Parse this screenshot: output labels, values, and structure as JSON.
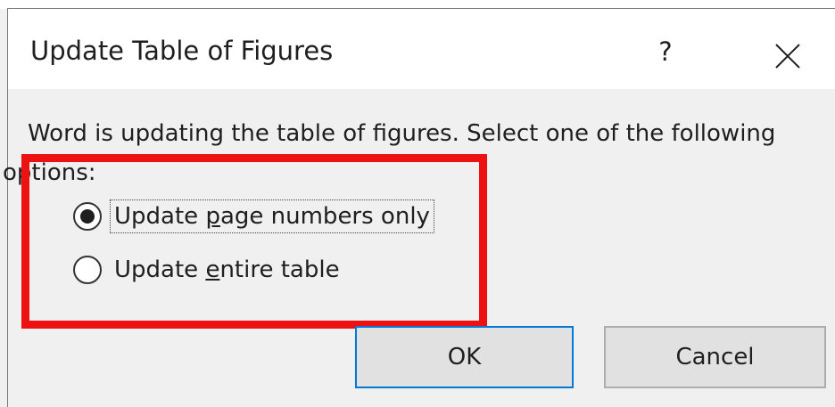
{
  "dialog": {
    "title": "Update Table of Figures",
    "help_label": "?",
    "close_icon": "close-icon",
    "message_line1": "Word is updating the table of figures.  Select one of the following",
    "message_line2": "options:",
    "options": [
      {
        "prefix": "Update ",
        "accel": "p",
        "suffix": "age numbers only",
        "selected": true
      },
      {
        "prefix": "Update ",
        "accel": "e",
        "suffix": "ntire table",
        "selected": false
      }
    ],
    "ok_label": "OK",
    "cancel_label": "Cancel"
  },
  "annotation": {
    "highlight_color": "#ee1111"
  }
}
